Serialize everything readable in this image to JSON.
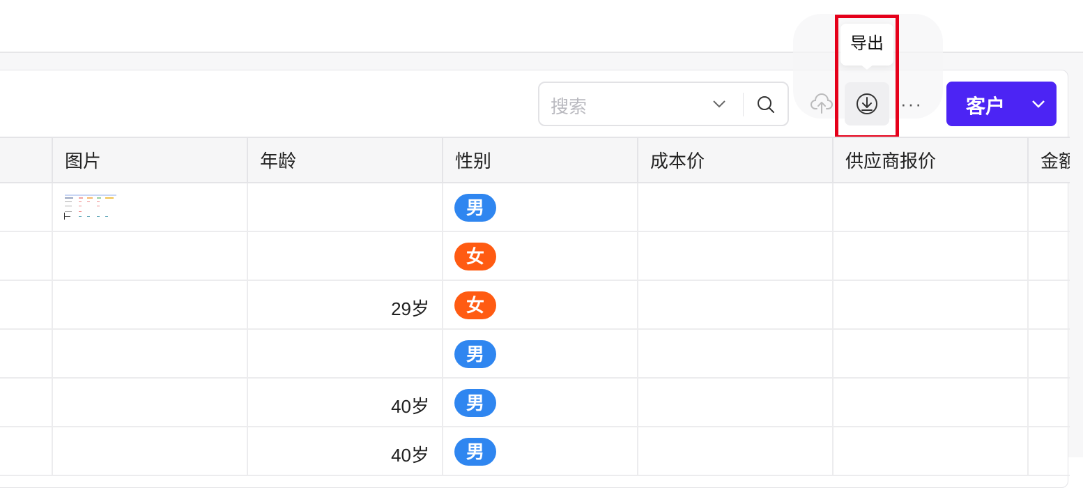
{
  "toolbar": {
    "search_placeholder": "搜索",
    "export_tooltip": "导出",
    "more_label": "···",
    "primary_button_label": "客户"
  },
  "colors": {
    "primary": "#4c24f4",
    "male_badge": "#2f86f0",
    "female_badge": "#ff5b12",
    "highlight": "#e5001a"
  },
  "table": {
    "columns": [
      "图片",
      "年龄",
      "性别",
      "成本价",
      "供应商报价",
      "金额"
    ],
    "rows": [
      {
        "image": "thumbnail",
        "age": "",
        "gender": "男"
      },
      {
        "image": "",
        "age": "",
        "gender": "女"
      },
      {
        "image": "",
        "age": "29岁",
        "gender": "女"
      },
      {
        "image": "",
        "age": "",
        "gender": "男"
      },
      {
        "image": "",
        "age": "40岁",
        "gender": "男"
      },
      {
        "image": "",
        "age": "40岁",
        "gender": "男"
      }
    ]
  },
  "icons": [
    "chevron-down-icon",
    "search-icon",
    "upload-icon",
    "download-icon",
    "more-icon"
  ]
}
